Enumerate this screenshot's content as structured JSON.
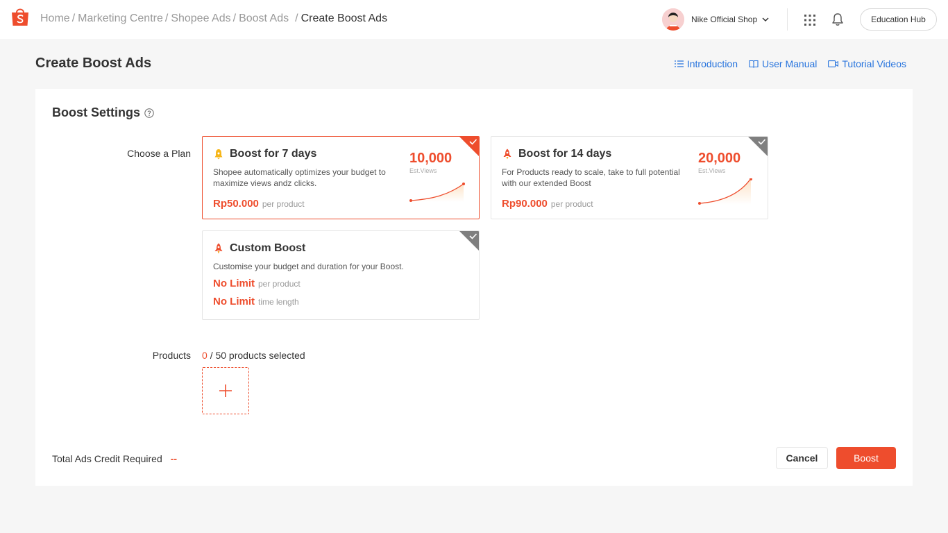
{
  "colors": {
    "accent": "#ee4d2d",
    "link": "#2673dd",
    "muted": "#999999"
  },
  "header": {
    "breadcrumbs": [
      "Home",
      "Marketing Centre",
      "Shopee Ads",
      "Boost Ads",
      "Create Boost Ads"
    ],
    "breadcrumb_sep": "/",
    "shop_name": "Nike Official Shop",
    "education_hub": "Education Hub",
    "icons": [
      "shopee-logo-icon",
      "chevron-down-icon",
      "apps-grid-icon",
      "bell-icon"
    ]
  },
  "page": {
    "title": "Create Boost Ads",
    "help_links": [
      {
        "label": "Introduction",
        "icon": "list-icon"
      },
      {
        "label": "User Manual",
        "icon": "book-icon"
      },
      {
        "label": "Tutorial Videos",
        "icon": "video-icon"
      }
    ]
  },
  "settings": {
    "title": "Boost Settings",
    "plan_label": "Choose a Plan",
    "plans": [
      {
        "title": "Boost for 7 days",
        "description": "Shopee automatically optimizes your budget to maximize views andz clicks.",
        "price": "Rp50.000",
        "price_unit": "per product",
        "views": "10,000",
        "views_label": "Est.Views",
        "selected": true
      },
      {
        "title": "Boost for 14 days",
        "description": "For Products ready to scale, take to full potential with our extended Boost",
        "price": "Rp90.000",
        "price_unit": "per product",
        "views": "20,000",
        "views_label": "Est.Views",
        "selected": false
      },
      {
        "title": "Custom Boost",
        "description": "Customise your budget and duration for your Boost.",
        "budget": "No Limit",
        "budget_unit": "per product",
        "duration": "No Limit",
        "duration_unit": "time length",
        "selected": false
      }
    ],
    "products_label": "Products",
    "products_selected": "0",
    "products_max_text": "/ 50 products selected",
    "total_label": "Total Ads Credit Required",
    "total_value": "--"
  },
  "actions": {
    "cancel": "Cancel",
    "boost": "Boost"
  }
}
